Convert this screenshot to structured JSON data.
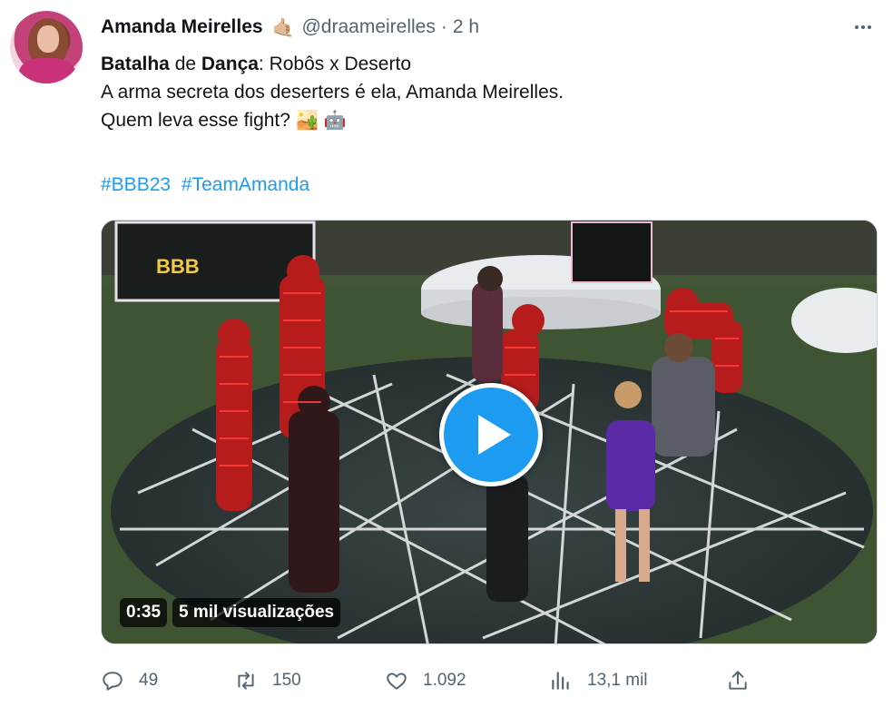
{
  "author": {
    "name": "Amanda Meirelles",
    "handle": "@draameirelles",
    "separator": "·",
    "time": "2 h",
    "emoji": "🤙🏼"
  },
  "tweet": {
    "line1_bold_a": "Batalha",
    "line1_plain_a": " de ",
    "line1_bold_b": "Dança",
    "line1_rest": ": Robôs x Deserto",
    "line2": "A arma secreta dos deserters é ela, Amanda Meirelles.",
    "line3": "Quem leva esse fight?",
    "line3_emoji_a": "🏜️",
    "line3_emoji_b": "🤖",
    "hashtags": [
      "#BBB23",
      "#TeamAmanda"
    ]
  },
  "video": {
    "duration": "0:35",
    "views": "5 mil visualizações",
    "logo_text": "BBB"
  },
  "actions": {
    "replies": "49",
    "retweets": "150",
    "likes": "1.092",
    "views": "13,1 mil"
  },
  "colors": {
    "accent": "#1d9bf0",
    "text": "#0f1419",
    "secondary": "#536471"
  },
  "icons": {
    "reply": "reply-icon",
    "retweet": "retweet-icon",
    "like": "heart-icon",
    "views": "views-chart-icon",
    "share": "share-icon",
    "more": "more-icon",
    "play": "play-icon"
  }
}
